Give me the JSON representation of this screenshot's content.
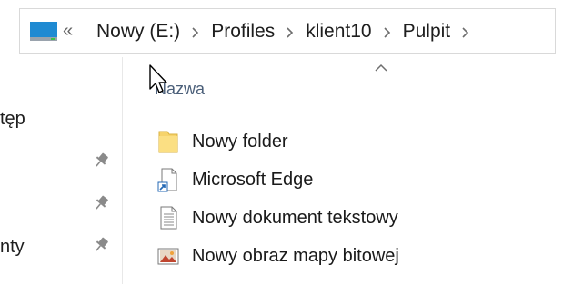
{
  "address_bar": {
    "overflow_glyph": "«",
    "breadcrumbs": [
      "Nowy (E:)",
      "Profiles",
      "klient10",
      "Pulpit"
    ]
  },
  "nav_pane": {
    "items": [
      {
        "label": "tęp",
        "icon": "pin-icon"
      },
      {
        "label": "",
        "icon": "pin-icon"
      },
      {
        "label": "",
        "icon": "pin-icon"
      },
      {
        "label": "nty",
        "icon": "pin-icon"
      }
    ]
  },
  "file_list": {
    "column_header": "Nazwa",
    "sort": "ascending",
    "items": [
      {
        "name": "Nowy folder",
        "icon": "folder-icon"
      },
      {
        "name": "Microsoft Edge",
        "icon": "shortcut-icon"
      },
      {
        "name": "Nowy dokument tekstowy",
        "icon": "text-document-icon"
      },
      {
        "name": "Nowy obraz mapy bitowej",
        "icon": "bitmap-image-icon"
      }
    ]
  },
  "colors": {
    "header_text": "#4c607a",
    "folder": "#f6d36b",
    "drive": "#1f8ad2"
  }
}
